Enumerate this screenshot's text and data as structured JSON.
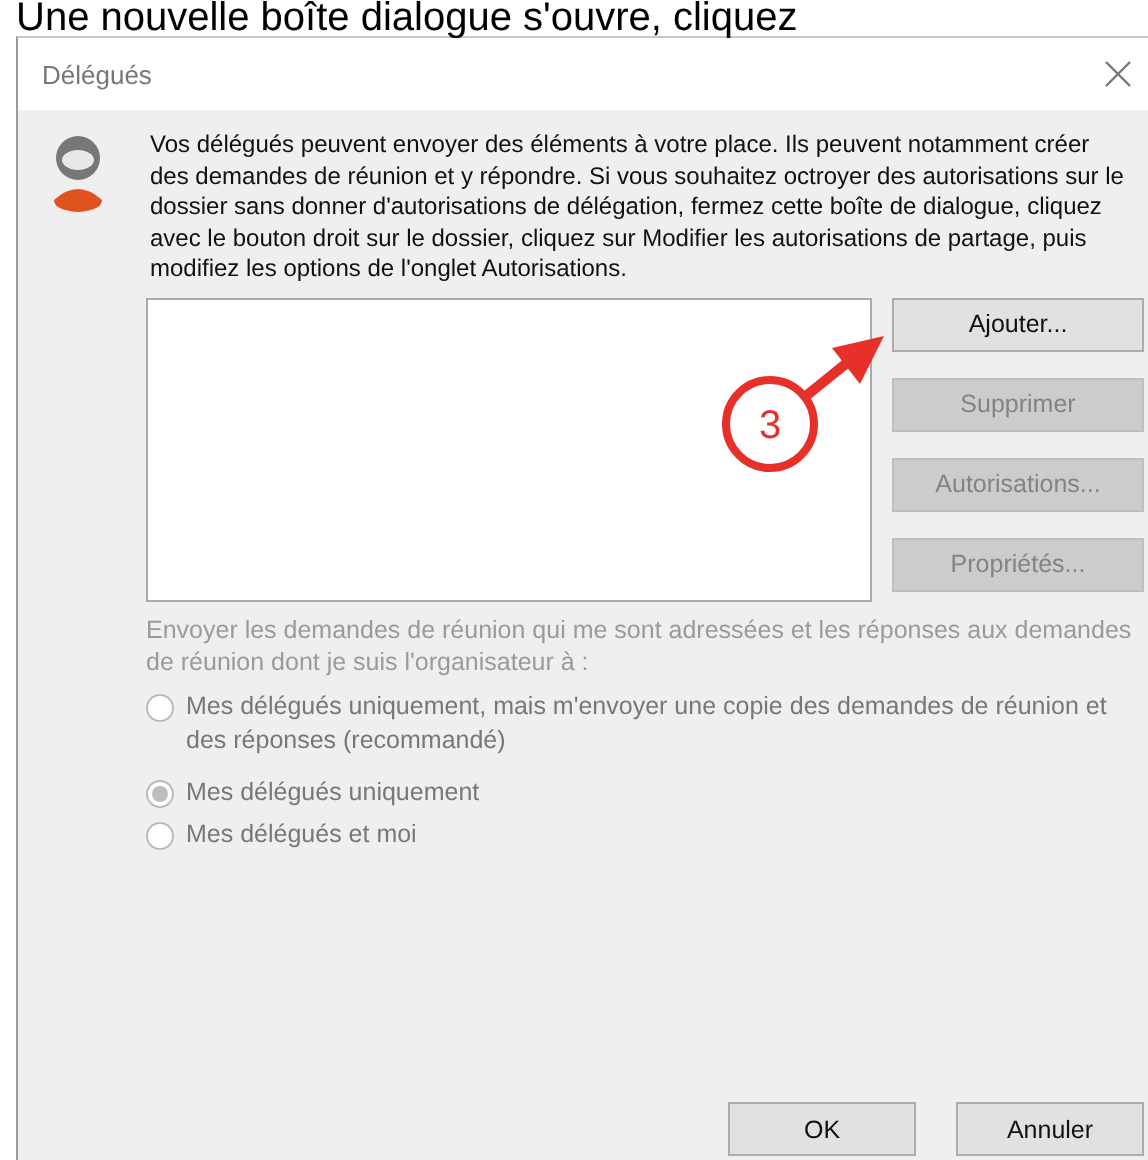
{
  "caption": "Une nouvelle boîte dialogue s'ouvre, cliquez",
  "window": {
    "title": "Délégués"
  },
  "intro": "Vos délégués peuvent envoyer des éléments à votre place. Ils peuvent notamment créer des demandes de réunion et y répondre. Si vous souhaitez octroyer des autorisations sur le dossier sans donner d'autorisations de délégation, fermez cette boîte de dialogue, cliquez avec le bouton droit sur le dossier, cliquez sur Modifier les autorisations de partage, puis modifiez les options de l'onglet Autorisations.",
  "side_buttons": [
    {
      "label": "Ajouter...",
      "disabled": false
    },
    {
      "label": "Supprimer",
      "disabled": true
    },
    {
      "label": "Autorisations...",
      "disabled": true
    },
    {
      "label": "Propriétés...",
      "disabled": true
    }
  ],
  "meeting_options": {
    "label": "Envoyer les demandes de réunion qui me sont adressées et les réponses aux demandes de réunion dont je suis l'organisateur à :",
    "disabled": true,
    "options": [
      {
        "label": "Mes délégués uniquement, mais m'envoyer une copie des demandes de réunion et des réponses (recommandé)",
        "selected": false
      },
      {
        "label": "Mes délégués uniquement",
        "selected": true
      },
      {
        "label": "Mes délégués et moi",
        "selected": false
      }
    ]
  },
  "buttons": [
    {
      "label": "OK"
    },
    {
      "label": "Annuler"
    }
  ],
  "annotation": {
    "number": "3"
  }
}
